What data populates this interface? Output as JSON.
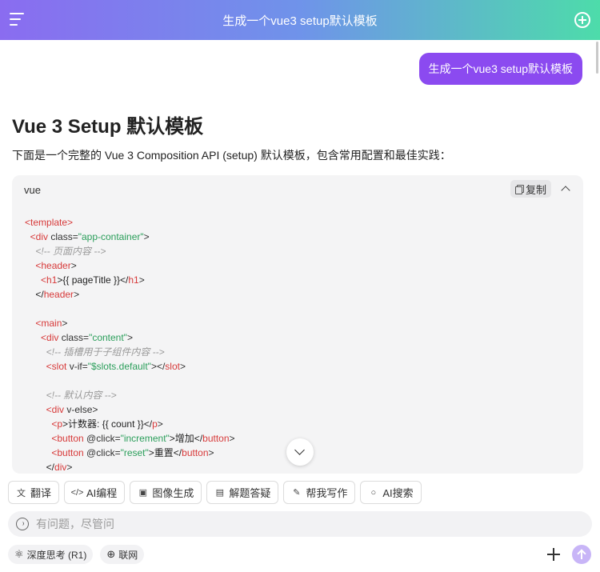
{
  "header": {
    "title": "生成一个vue3 setup默认模板"
  },
  "conversation": {
    "user_message": "生成一个vue3 setup默认模板",
    "answer_title": "Vue 3 Setup 默认模板",
    "answer_intro": "下面是一个完整的 Vue 3 Composition API (setup) 默认模板，包含常用配置和最佳实践："
  },
  "code_block": {
    "language": "vue",
    "copy_label": "复制",
    "lines": [
      [
        {
          "t": "<",
          "c": "tag"
        },
        {
          "t": "template",
          "c": "tag"
        },
        {
          "t": ">",
          "c": "tag"
        }
      ],
      [
        {
          "t": "  ",
          "c": "txt"
        },
        {
          "t": "<div",
          "c": "tag"
        },
        {
          "t": " class=",
          "c": "attr"
        },
        {
          "t": "\"app-container\"",
          "c": "str"
        },
        {
          "t": ">",
          "c": "attr"
        }
      ],
      [
        {
          "t": "    <!-- 页面内容 -->",
          "c": "com"
        }
      ],
      [
        {
          "t": "    ",
          "c": "txt"
        },
        {
          "t": "<header",
          "c": "tag"
        },
        {
          "t": ">",
          "c": "attr"
        }
      ],
      [
        {
          "t": "      ",
          "c": "txt"
        },
        {
          "t": "<h1",
          "c": "tag"
        },
        {
          "t": ">{{ pageTitle }}</",
          "c": "txt"
        },
        {
          "t": "h1",
          "c": "tag"
        },
        {
          "t": ">",
          "c": "attr"
        }
      ],
      [
        {
          "t": "    </",
          "c": "txt"
        },
        {
          "t": "header",
          "c": "tag"
        },
        {
          "t": ">",
          "c": "attr"
        }
      ],
      [
        {
          "t": "",
          "c": "txt"
        }
      ],
      [
        {
          "t": "    ",
          "c": "txt"
        },
        {
          "t": "<main",
          "c": "tag"
        },
        {
          "t": ">",
          "c": "attr"
        }
      ],
      [
        {
          "t": "      ",
          "c": "txt"
        },
        {
          "t": "<div",
          "c": "tag"
        },
        {
          "t": " class=",
          "c": "attr"
        },
        {
          "t": "\"content\"",
          "c": "str"
        },
        {
          "t": ">",
          "c": "attr"
        }
      ],
      [
        {
          "t": "        <!-- 插槽用于子组件内容 -->",
          "c": "com"
        }
      ],
      [
        {
          "t": "        ",
          "c": "txt"
        },
        {
          "t": "<slot",
          "c": "tag"
        },
        {
          "t": " v-if=",
          "c": "attr"
        },
        {
          "t": "\"$slots.default\"",
          "c": "str"
        },
        {
          "t": "></",
          "c": "attr"
        },
        {
          "t": "slot",
          "c": "tag"
        },
        {
          "t": ">",
          "c": "attr"
        }
      ],
      [
        {
          "t": "",
          "c": "txt"
        }
      ],
      [
        {
          "t": "        <!-- 默认内容 -->",
          "c": "com"
        }
      ],
      [
        {
          "t": "        ",
          "c": "txt"
        },
        {
          "t": "<div",
          "c": "tag"
        },
        {
          "t": " v-else",
          "c": "attr"
        },
        {
          "t": ">",
          "c": "attr"
        }
      ],
      [
        {
          "t": "          ",
          "c": "txt"
        },
        {
          "t": "<p",
          "c": "tag"
        },
        {
          "t": ">计数器: {{ count }}</",
          "c": "txt"
        },
        {
          "t": "p",
          "c": "tag"
        },
        {
          "t": ">",
          "c": "attr"
        }
      ],
      [
        {
          "t": "          ",
          "c": "txt"
        },
        {
          "t": "<button",
          "c": "tag"
        },
        {
          "t": " @click=",
          "c": "attr"
        },
        {
          "t": "\"increment\"",
          "c": "str"
        },
        {
          "t": ">增加</",
          "c": "txt"
        },
        {
          "t": "button",
          "c": "tag"
        },
        {
          "t": ">",
          "c": "attr"
        }
      ],
      [
        {
          "t": "          ",
          "c": "txt"
        },
        {
          "t": "<button",
          "c": "tag"
        },
        {
          "t": " @click=",
          "c": "attr"
        },
        {
          "t": "\"reset\"",
          "c": "str"
        },
        {
          "t": ">重置</",
          "c": "txt"
        },
        {
          "t": "button",
          "c": "tag"
        },
        {
          "t": ">",
          "c": "attr"
        }
      ],
      [
        {
          "t": "        </",
          "c": "txt"
        },
        {
          "t": "div",
          "c": "tag"
        },
        {
          "t": ">",
          "c": "attr"
        }
      ]
    ]
  },
  "toolbar": {
    "chips": [
      {
        "label": "翻译",
        "icon": "translate-icon",
        "glyph": "文"
      },
      {
        "label": "AI编程",
        "icon": "code-icon",
        "glyph": "</>"
      },
      {
        "label": "图像生成",
        "icon": "image-icon",
        "glyph": "▣"
      },
      {
        "label": "解题答疑",
        "icon": "question-doc-icon",
        "glyph": "▤"
      },
      {
        "label": "帮我写作",
        "icon": "pen-icon",
        "glyph": "✎"
      },
      {
        "label": "AI搜索",
        "icon": "search-icon",
        "glyph": "○"
      }
    ]
  },
  "composer": {
    "placeholder": "有问题，尽管问",
    "deep_think_label": "深度思考 (R1)",
    "web_search_label": "联网"
  },
  "colors": {
    "header_gradient_start": "#8a6cf0",
    "header_gradient_end": "#4ddcaa",
    "user_bubble": "#8b4af0",
    "send_button": "#c8b5f7"
  }
}
